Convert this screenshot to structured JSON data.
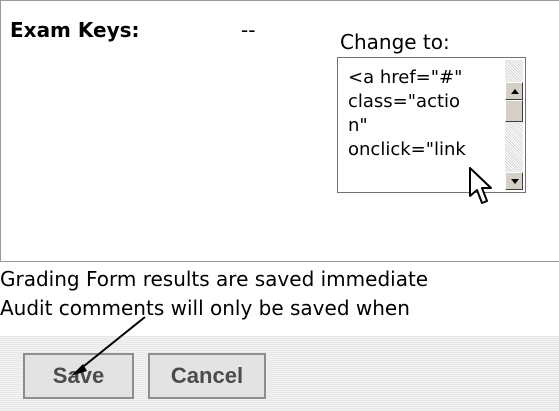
{
  "form": {
    "exam_label": "Exam Keys:",
    "current_value": "--",
    "change_label": "Change to:",
    "textarea_value": "<a href=\"#\"\nclass=\"actio\nn\"\nonclick=\"link"
  },
  "messages": {
    "line1": "Grading Form results are saved immediate",
    "line2": "Audit comments will only be saved when"
  },
  "buttons": {
    "save": "Save",
    "cancel": "Cancel"
  },
  "colors": {
    "panel_border": "#999999",
    "button_text": "#4b4b4b",
    "button_background": "#e3e3e3",
    "annotation_arrow": "#000000"
  },
  "icons": {
    "cursor": "mouse-pointer-icon",
    "scroll_up": "scroll-up-icon",
    "scroll_down": "scroll-down-icon",
    "annotation": "annotation-arrow-icon"
  }
}
